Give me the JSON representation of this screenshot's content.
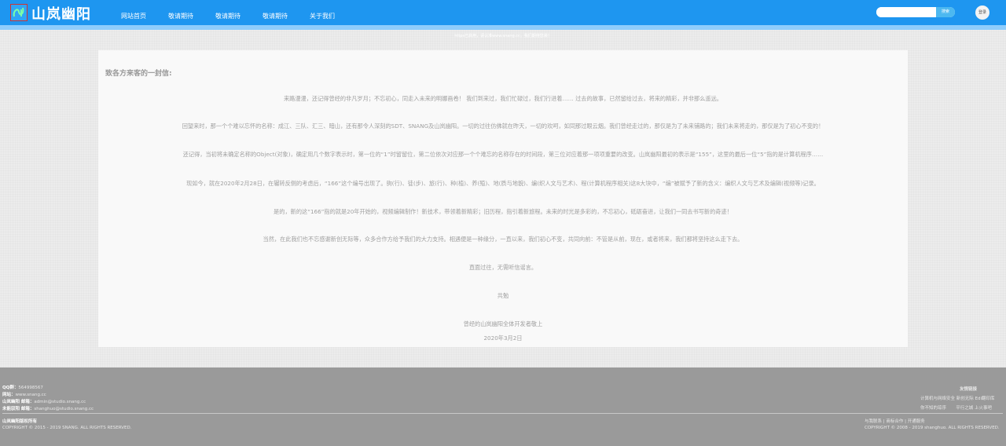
{
  "header": {
    "site_name": "山岚幽阳",
    "nav": [
      "网站首页",
      "敬请期待",
      "敬请期待",
      "敬请期待",
      "关于我们"
    ],
    "search_placeholder": "",
    "search_button": "搜索",
    "avatar_label": "登录",
    "notice": "https已启用，请认准www.snang.cc，我们期待您来！"
  },
  "letter": {
    "title": "致各方来客的一封信:",
    "paragraphs": [
      "来路漫漫，还记得曾经的非凡岁月；不忘初心，同走入未来的明娜画卷！ 我们到来过，我们忙碌过，我们行进着…… 过去的故事，已然留给过去，将来的精彩，并非那么遥远。",
      "回望来时，那一个个难以忘怀的名称：成江、三队、汇三、暗山，还有那令人深刻的SDT、SNANG及山岚幽阳。一切的过往仿佛就在昨天，一切的欢呵，如同那过眼云烟。我们曾经走过的，那仅是为了未来铺路的；我们未来将走的，那仅是为了初心不变的！",
      "还记得，当初将未确定名称的Object(对象)，确定用几个数字表示时，第一位的“1”时留留位，第二位依次对应那一个个难忘的名称存在的时间段，第三位对应着那一项项重要的改变。山岚幽阳最初的表示是“155”，这里的最后一位“5”指的是计算机程序……",
      "现如今，就在2020年2月28日，在辗转反侧的考虑后，“166”这个编号出现了。驹(行)、徒(步)、旅(行)、种(植)、养(殖)、地(质与地貌)、编(织人文与艺术)、程(计算机程序相关)这8大块中，“编”被赋予了新的含义：编织人文与艺术及编辑(视频等)记录。",
      "是的，新的这“166”指的就是20年开始的，视频编辑制作！新技术，带领着新精彩；旧历程，指引着新旅程。未来的时光是多彩的，不忘初心，砥砺奋进，让我们一同去书写新的奇迹！",
      "当然，在此我们也不忘感谢新创无际等，众多合作方给予我们的大力支持。相遇便是一种缘分，一直以来，我们初心不变，共同向前：不管是从前，现在，或者将来，我们都将坚持这么走下去。",
      "直面过往，无需听信谣言。",
      "共勉",
      "曾经的山岚幽阳全体开发者敬上",
      "2020年3月2日"
    ]
  },
  "footer": {
    "qq_label": "QQ群：",
    "qq_value": "564998567",
    "site_label": "网站：",
    "site_value": "www.snang.cc",
    "mail1_label": "山岚幽阳 邮箱：",
    "mail1_value": "admin@studio.snang.cc",
    "mail2_label": "未能驭阳 邮箱：",
    "mail2_value": "shanghuo@studio.snang.cc",
    "rights_owner": "山岚幽阳版权所有",
    "copyright_left": "COPYRIGHT © 2015 - 2019 SNANG. ALL RIGHTS RESERVED.",
    "friends_title": "友情链接",
    "friends_row1": [
      "计算机与网络安全",
      "新创无际",
      "Edi翻印库"
    ],
    "friends_row2": [
      "你不知的琼序",
      "平行之城",
      "上火事吧"
    ],
    "links_line": [
      "与我联系",
      "商标合作",
      "开通服务"
    ],
    "copyright_right": "COPYRIGHT © 2008 - 2019 shanghuo. ALL RIGHTS RESERVED."
  },
  "colors": {
    "header_bg": "#1e96f0",
    "subbar_bg": "#8fcdfc",
    "footer_bg": "#9a9a9a",
    "card_bg": "#f9f9f9"
  }
}
